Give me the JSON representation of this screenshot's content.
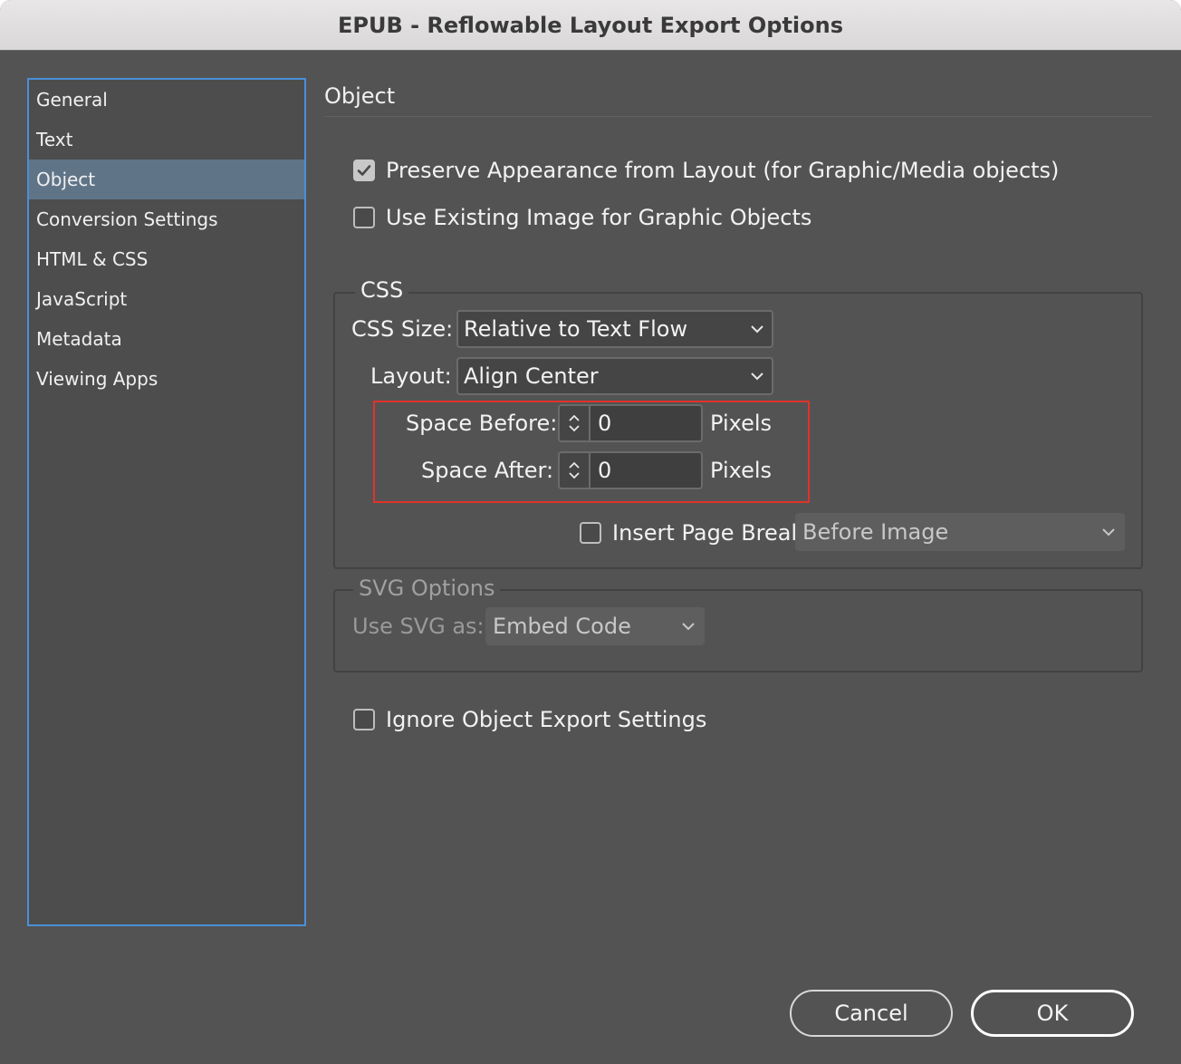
{
  "window": {
    "title": "EPUB - Reflowable Layout Export Options"
  },
  "sidebar": {
    "items": [
      {
        "label": "General",
        "selected": false
      },
      {
        "label": "Text",
        "selected": false
      },
      {
        "label": "Object",
        "selected": true
      },
      {
        "label": "Conversion Settings",
        "selected": false
      },
      {
        "label": "HTML & CSS",
        "selected": false
      },
      {
        "label": "JavaScript",
        "selected": false
      },
      {
        "label": "Metadata",
        "selected": false
      },
      {
        "label": "Viewing Apps",
        "selected": false
      }
    ]
  },
  "panel": {
    "title": "Object",
    "preserve_appearance": {
      "label": "Preserve Appearance from Layout (for Graphic/Media objects)",
      "checked": true
    },
    "use_existing_image": {
      "label": "Use Existing Image for Graphic Objects",
      "checked": false
    },
    "css": {
      "title": "CSS",
      "css_size": {
        "label": "CSS Size:",
        "value": "Relative to Text Flow"
      },
      "layout": {
        "label": "Layout:",
        "value": "Align Center"
      },
      "space_before": {
        "label": "Space Before:",
        "value": "0",
        "unit": "Pixels"
      },
      "space_after": {
        "label": "Space After:",
        "value": "0",
        "unit": "Pixels"
      },
      "page_break": {
        "label": "Insert Page Break",
        "checked": false,
        "value": "Before Image"
      }
    },
    "svg": {
      "title": "SVG Options",
      "use_svg_as": {
        "label": "Use SVG as:",
        "value": "Embed Code"
      }
    },
    "ignore_export": {
      "label": "Ignore Object Export Settings",
      "checked": false
    }
  },
  "buttons": {
    "cancel": "Cancel",
    "ok": "OK"
  },
  "colors": {
    "highlight": "#e0332b",
    "selection": "#607488",
    "focus_border": "#4a8fd8"
  }
}
